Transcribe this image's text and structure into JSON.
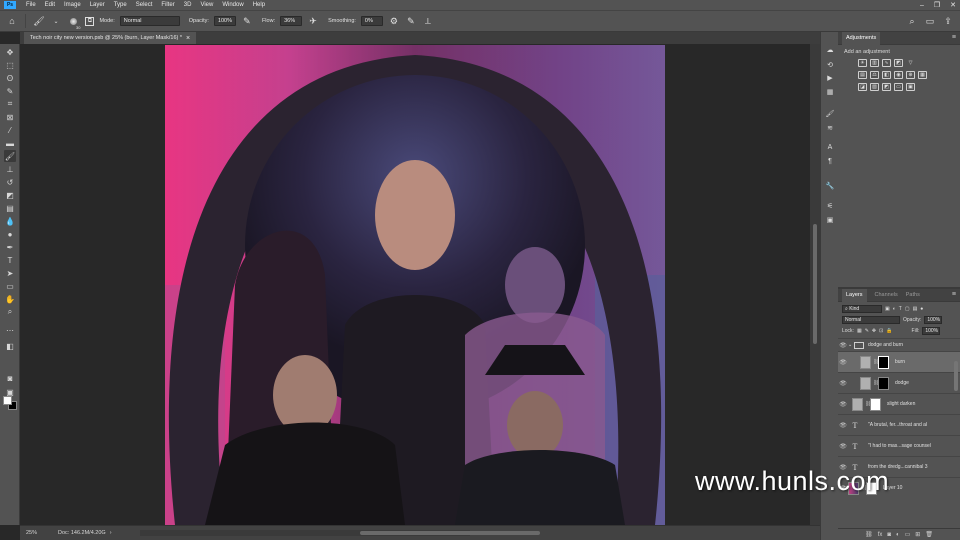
{
  "menu": [
    "File",
    "Edit",
    "Image",
    "Layer",
    "Type",
    "Select",
    "Filter",
    "3D",
    "View",
    "Window",
    "Help"
  ],
  "window_controls": [
    "–",
    "❐",
    "✕"
  ],
  "options": {
    "brush_size": "30",
    "mode_label": "Mode:",
    "mode_value": "Normal",
    "opacity_label": "Opacity:",
    "opacity_value": "100%",
    "flow_label": "Flow:",
    "flow_value": "36%",
    "smoothing_label": "Smoothing:",
    "smoothing_value": "0%"
  },
  "document": {
    "tab_title": "Tech noir city new version.psb @ 25% (burn, Layer Mask/16) *",
    "close_glyph": "×"
  },
  "status": {
    "zoom": "25%",
    "doc_size": "Doc: 146.2M/4.20G"
  },
  "adjustments": {
    "title": "Adjustments",
    "subtitle": "Add an adjustment"
  },
  "layers_panel": {
    "tabs": [
      "Layers",
      "Channels",
      "Paths"
    ],
    "kind_label": "Kind",
    "blend_mode": "Normal",
    "opacity_label": "Opacity:",
    "opacity_value": "100%",
    "lock_label": "Lock:",
    "fill_label": "Fill:",
    "fill_value": "100%",
    "rows": [
      {
        "name": "dodge and burn"
      },
      {
        "name": "burn"
      },
      {
        "name": "dodge"
      },
      {
        "name": "slight darken"
      },
      {
        "name": "\"A brutal, fer...throat and al"
      },
      {
        "name": "\"I had to mas...sage counsel"
      },
      {
        "name": "from the dredg...cannibal 3"
      },
      {
        "name": "Layer 10"
      }
    ]
  },
  "watermark": "www.hunls.com"
}
